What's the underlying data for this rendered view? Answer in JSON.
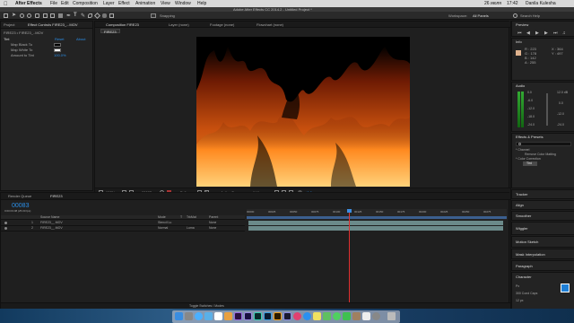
{
  "menubar": {
    "apple": "",
    "app": "After Effects",
    "items": [
      "File",
      "Edit",
      "Composition",
      "Layer",
      "Effect",
      "Animation",
      "View",
      "Window",
      "Help"
    ],
    "status": {
      "date": "26 июля",
      "time": "17:42",
      "user": "Danila Kulesha"
    }
  },
  "window_title": "Adobe After Effects CC 2014.2 - Untitled Project *",
  "toolbar": {
    "snapping": "Snapping",
    "workspace_label": "Workspace:",
    "workspace_value": "All Panels",
    "search_help": "Search Help"
  },
  "project": {
    "tabs": [
      "Project",
      "Effect Controls FIRE23_...MOV"
    ],
    "breadcrumb": "FIRE23 • FIRE23_..MOV",
    "effect_name": "Tint",
    "reset": "Reset",
    "about": "About",
    "props": [
      {
        "label": "Map Black To",
        "value": ""
      },
      {
        "label": "Map White To",
        "value": ""
      },
      {
        "label": "Amount to Tint",
        "value": "100.0%"
      }
    ]
  },
  "viewer": {
    "tabs": [
      "Composition FIRE23",
      "Layer (none)",
      "Footage (none)",
      "Flowchart (none)"
    ],
    "comp_tab": "FIRE23",
    "zoom": "100%",
    "timecode": "00083",
    "resolution": "Full",
    "camera": "Active Camera",
    "views": "1 View",
    "exposure": "+0.0"
  },
  "right": {
    "preview": "Preview",
    "info": "Info",
    "info_values": [
      "R : 223",
      "G : 178",
      "B : 142",
      "A : 255"
    ],
    "info_xy": [
      "X : 364",
      "Y : 497"
    ],
    "audio": "Audio",
    "audio_db": [
      "0.0",
      "-6.0",
      "-12.0",
      "-18.0",
      "-24.0"
    ],
    "audio_db_r": [
      "12.0 dB",
      "0.0",
      "-12.0",
      "-24.0"
    ],
    "effects_presets": "Effects & Presets",
    "ep_items": [
      "* Channel",
      "Remove Color Matting",
      "* Color Correction",
      "Tint"
    ],
    "panels": [
      "Tracker",
      "Align",
      "Smoother",
      "Wiggler",
      "Motion Sketch",
      "Mask Interpolation",
      "Paragraph",
      "Character"
    ],
    "char_size": "12 px",
    "char_font": "300 Cond Caps",
    "char_px": "Px"
  },
  "timeline": {
    "tabs": [
      "Render Queue",
      "FIRE23"
    ],
    "timecode": "00083",
    "fps": "0:00:03:08 (25.00 fps)",
    "columns": [
      "Source Name",
      "Mode",
      "T",
      "TrkMat",
      "Parent"
    ],
    "layers": [
      {
        "num": "1",
        "name": "FIRE23__.MOV",
        "mode": "Stencil Lu",
        "trk": "",
        "parent": "None"
      },
      {
        "num": "2",
        "name": "FIRE23__.MOV",
        "mode": "Normal",
        "trk": "Luma",
        "parent": "None"
      }
    ],
    "ruler": [
      "00000",
      "00025",
      "00050",
      "00075",
      "00100",
      "00125",
      "00150",
      "00175",
      "00200",
      "00225",
      "00250",
      "00275"
    ],
    "footer": "Toggle Switches / Modes"
  },
  "dock": {
    "icons": [
      "finder",
      "launchpad",
      "safari",
      "mail",
      "calendar",
      "photos",
      "premiere",
      "after-effects",
      "audition",
      "photoshop",
      "illustrator",
      "media-encoder",
      "music",
      "app-store",
      "notes",
      "maps",
      "messages",
      "facetime",
      "contacts",
      "reminders",
      "preferences",
      "trash"
    ]
  }
}
